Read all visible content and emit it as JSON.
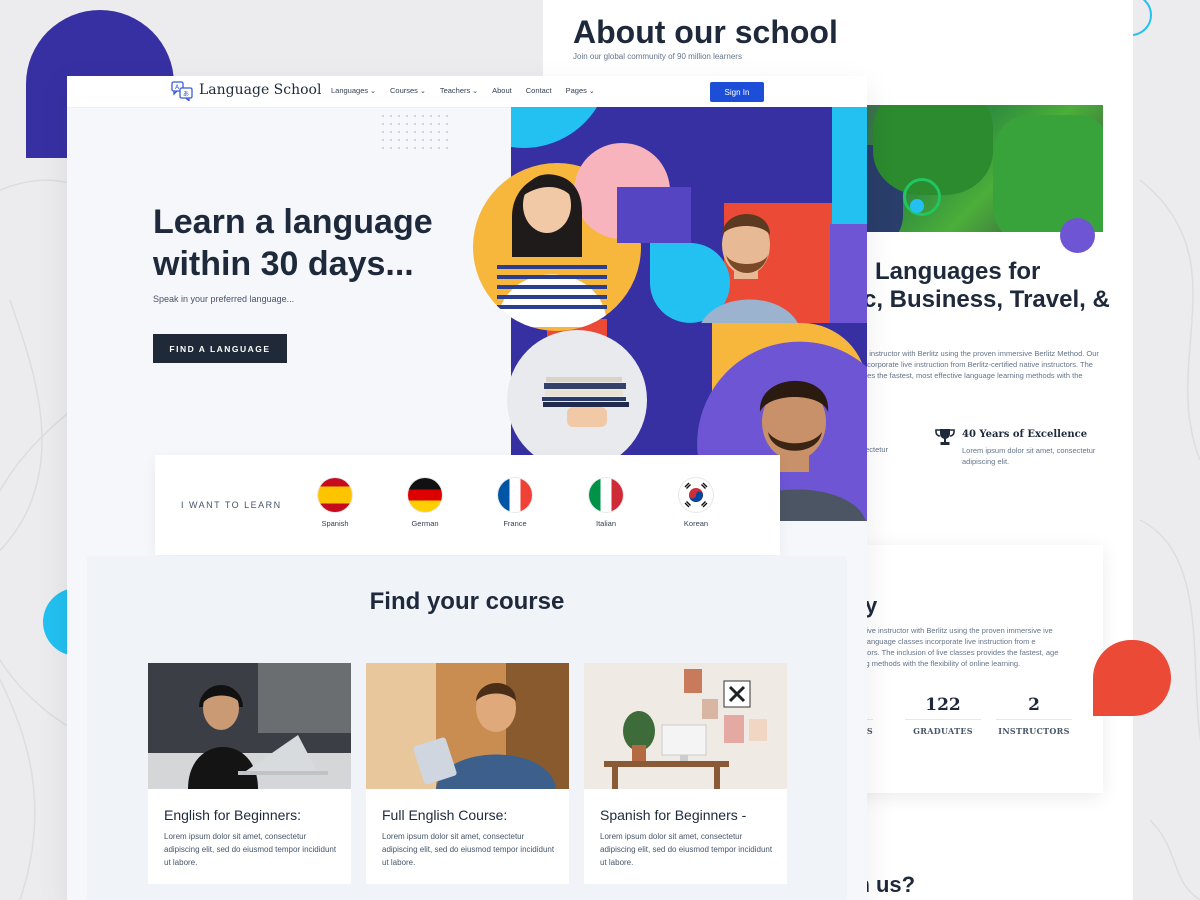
{
  "back_page": {
    "title": "About our school",
    "subtitle": "Join our global community of 90 million learners",
    "heading_lines": [
      "Languages for",
      "c, Business, Travel, &"
    ],
    "paragraph": "e instructor with Berlitz using the proven immersive Berlitz Method. Our ncorporate live instruction from Berlitz-certified native instructors. The des the fastest, most effective language learning methods with the",
    "feature": {
      "title": "40 Years of Excellence",
      "text": "Lorem ipsum dolor sit amet, consectetur adipiscing elit.",
      "icon": "trophy-icon"
    },
    "left_fragment": "t, consectetur",
    "history": {
      "title": "ory",
      "text": "with a live instructor with Berlitz using the proven immersive ive online language classes incorporate live instruction from e instructors. The inclusion of live classes provides the fastest, age learning methods with the flexibility of online learning.",
      "stats": [
        {
          "value": "",
          "label": "S"
        },
        {
          "value": "122",
          "label": "GRADUATES"
        },
        {
          "value": "2",
          "label": "INSTRUCTORS"
        }
      ]
    },
    "bottom_heading": "ith us?"
  },
  "nav": {
    "logo_text": "Language School",
    "items": [
      {
        "label": "Languages",
        "dropdown": true
      },
      {
        "label": "Courses",
        "dropdown": true
      },
      {
        "label": "Teachers",
        "dropdown": true
      },
      {
        "label": "About",
        "dropdown": false
      },
      {
        "label": "Contact",
        "dropdown": false
      },
      {
        "label": "Pages",
        "dropdown": true
      }
    ],
    "signin_label": "Sign In"
  },
  "hero": {
    "title": "Learn a language within 30 days...",
    "subtitle": "Speak in your preferred language...",
    "button_label": "FIND A LANGUAGE"
  },
  "learn": {
    "label": "I WANT TO LEARN",
    "languages": [
      {
        "name": "Spanish",
        "flag": "spain-flag"
      },
      {
        "name": "German",
        "flag": "germany-flag"
      },
      {
        "name": "France",
        "flag": "france-flag"
      },
      {
        "name": "Italian",
        "flag": "italy-flag"
      },
      {
        "name": "Korean",
        "flag": "korea-flag"
      }
    ]
  },
  "courses": {
    "title": "Find your course",
    "items": [
      {
        "title": "English for Beginners:",
        "description": "Lorem ipsum dolor sit amet, consectetur adipiscing elit, sed do eiusmod tempor incididunt ut labore."
      },
      {
        "title": "Full English Course:",
        "description": "Lorem ipsum dolor sit amet, consectetur adipiscing elit, sed do eiusmod tempor incididunt ut labore."
      },
      {
        "title": "Spanish for Beginners -",
        "description": "Lorem ipsum dolor sit amet, consectetur adipiscing elit, sed do eiusmod tempor incididunt ut labore."
      }
    ]
  },
  "colors": {
    "primary_blue": "#1d4ed8",
    "dark_button": "#1f2937",
    "collage_indigo": "#3730a3",
    "collage_cyan": "#22c1f1",
    "collage_red": "#ea4a36",
    "collage_yellow": "#f6b73c",
    "collage_violet": "#6d55d4",
    "collage_pink": "#f8b4bd"
  }
}
